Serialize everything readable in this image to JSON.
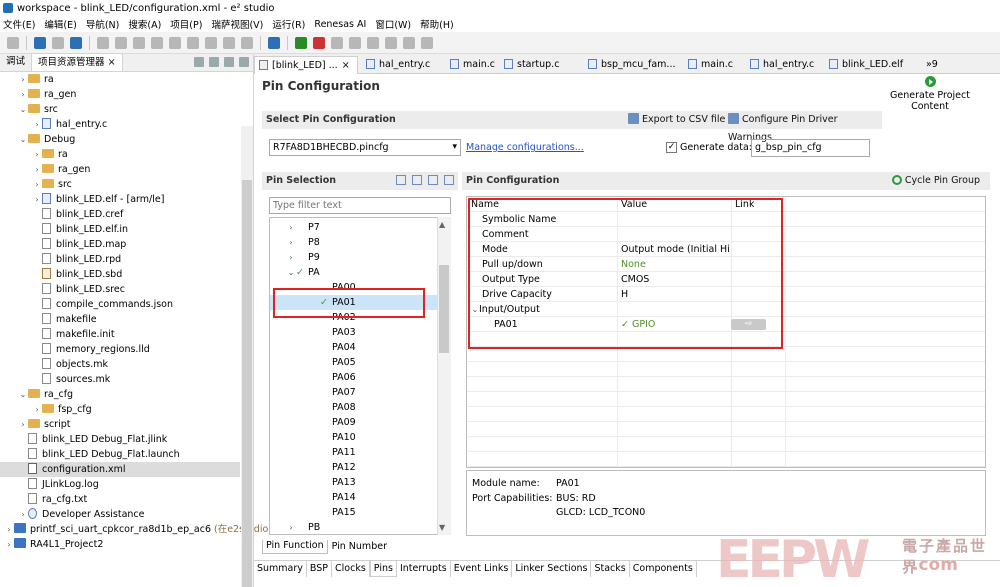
{
  "window": {
    "title": "workspace - blink_LED/configuration.xml - e² studio"
  },
  "menu": [
    "文件(E)",
    "编辑(E)",
    "导航(N)",
    "搜索(A)",
    "项目(P)",
    "瑞萨视图(V)",
    "运行(R)",
    "Renesas AI",
    "窗口(W)",
    "帮助(H)"
  ],
  "left_panel": {
    "tabs": [
      "调试",
      "项目资源管理器"
    ],
    "close_glyph": "×",
    "tree": [
      {
        "label": "ra",
        "depth": 1,
        "kind": "folder",
        "exp": "›"
      },
      {
        "label": "ra_gen",
        "depth": 1,
        "kind": "folder",
        "exp": "›"
      },
      {
        "label": "src",
        "depth": 1,
        "kind": "folder",
        "exp": "⌄"
      },
      {
        "label": "hal_entry.c",
        "depth": 2,
        "kind": "c",
        "exp": "›"
      },
      {
        "label": "Debug",
        "depth": 1,
        "kind": "folder",
        "exp": "⌄"
      },
      {
        "label": "ra",
        "depth": 2,
        "kind": "folder",
        "exp": "›"
      },
      {
        "label": "ra_gen",
        "depth": 2,
        "kind": "folder",
        "exp": "›"
      },
      {
        "label": "src",
        "depth": 2,
        "kind": "folder",
        "exp": "›"
      },
      {
        "label": "blink_LED.elf - [arm/le]",
        "depth": 2,
        "kind": "elf",
        "exp": "›"
      },
      {
        "label": "blink_LED.cref",
        "depth": 2,
        "kind": "file",
        "exp": ""
      },
      {
        "label": "blink_LED.elf.in",
        "depth": 2,
        "kind": "file",
        "exp": ""
      },
      {
        "label": "blink_LED.map",
        "depth": 2,
        "kind": "file",
        "exp": ""
      },
      {
        "label": "blink_LED.rpd",
        "depth": 2,
        "kind": "file",
        "exp": ""
      },
      {
        "label": "blink_LED.sbd",
        "depth": 2,
        "kind": "x",
        "exp": ""
      },
      {
        "label": "blink_LED.srec",
        "depth": 2,
        "kind": "file",
        "exp": ""
      },
      {
        "label": "compile_commands.json",
        "depth": 2,
        "kind": "file",
        "exp": ""
      },
      {
        "label": "makefile",
        "depth": 2,
        "kind": "file",
        "exp": ""
      },
      {
        "label": "makefile.init",
        "depth": 2,
        "kind": "file",
        "exp": ""
      },
      {
        "label": "memory_regions.lld",
        "depth": 2,
        "kind": "file",
        "exp": ""
      },
      {
        "label": "objects.mk",
        "depth": 2,
        "kind": "file",
        "exp": ""
      },
      {
        "label": "sources.mk",
        "depth": 2,
        "kind": "file",
        "exp": ""
      },
      {
        "label": "ra_cfg",
        "depth": 1,
        "kind": "folder",
        "exp": "⌄"
      },
      {
        "label": "fsp_cfg",
        "depth": 2,
        "kind": "folder",
        "exp": "›"
      },
      {
        "label": "script",
        "depth": 1,
        "kind": "folder",
        "exp": "›"
      },
      {
        "label": "blink_LED Debug_Flat.jlink",
        "depth": 1,
        "kind": "file",
        "exp": ""
      },
      {
        "label": "blink_LED Debug_Flat.launch",
        "depth": 1,
        "kind": "file",
        "exp": ""
      },
      {
        "label": "configuration.xml",
        "depth": 1,
        "kind": "gear",
        "exp": "",
        "selected": true
      },
      {
        "label": "JLinkLog.log",
        "depth": 1,
        "kind": "file",
        "exp": ""
      },
      {
        "label": "ra_cfg.txt",
        "depth": 1,
        "kind": "file",
        "exp": ""
      },
      {
        "label": "Developer Assistance",
        "depth": 1,
        "kind": "help",
        "exp": "›"
      },
      {
        "label": "printf_sci_uart_cpkcor_ra8d1b_ep_ac6",
        "depth": 0,
        "kind": "proj",
        "exp": "›",
        "extra": "(在e2studio"
      },
      {
        "label": "RA4L1_Project2",
        "depth": 0,
        "kind": "proj",
        "exp": "›"
      }
    ]
  },
  "editor_tabs": [
    {
      "label": "[blink_LED] ...",
      "active": true,
      "close": "×"
    },
    {
      "label": "hal_entry.c"
    },
    {
      "label": "main.c"
    },
    {
      "label": "startup.c"
    },
    {
      "label": "bsp_mcu_fam..."
    },
    {
      "label": "main.c"
    },
    {
      "label": "hal_entry.c"
    },
    {
      "label": "blink_LED.elf"
    },
    {
      "label": "»9"
    }
  ],
  "page": {
    "title": "Pin Configuration",
    "generate_button": "Generate Project Content",
    "select_pin_config": {
      "header": "Select Pin Configuration",
      "export_csv": "Export to CSV file",
      "configure_warnings": "Configure Pin Driver Warnings",
      "selected_file": "R7FA8D1BHECBD.pincfg",
      "manage_link": "Manage configurations...",
      "generate_data_label": "Generate data:",
      "generate_data_checked": "✓",
      "generate_data_value": "g_bsp_pin_cfg"
    },
    "pin_selection": {
      "header": "Pin Selection",
      "filter_placeholder": "Type filter text",
      "items": [
        {
          "label": "P7",
          "depth": 1,
          "exp": "›"
        },
        {
          "label": "P8",
          "depth": 1,
          "exp": "›"
        },
        {
          "label": "P9",
          "depth": 1,
          "exp": "›"
        },
        {
          "label": "PA",
          "depth": 1,
          "exp": "⌄",
          "check": "✓"
        },
        {
          "label": "PA00",
          "depth": 2,
          "exp": ""
        },
        {
          "label": "PA01",
          "depth": 2,
          "exp": "",
          "check": "✓",
          "selected": true
        },
        {
          "label": "PA02",
          "depth": 2,
          "exp": ""
        },
        {
          "label": "PA03",
          "depth": 2,
          "exp": ""
        },
        {
          "label": "PA04",
          "depth": 2,
          "exp": ""
        },
        {
          "label": "PA05",
          "depth": 2,
          "exp": ""
        },
        {
          "label": "PA06",
          "depth": 2,
          "exp": ""
        },
        {
          "label": "PA07",
          "depth": 2,
          "exp": ""
        },
        {
          "label": "PA08",
          "depth": 2,
          "exp": ""
        },
        {
          "label": "PA09",
          "depth": 2,
          "exp": ""
        },
        {
          "label": "PA10",
          "depth": 2,
          "exp": ""
        },
        {
          "label": "PA11",
          "depth": 2,
          "exp": ""
        },
        {
          "label": "PA12",
          "depth": 2,
          "exp": ""
        },
        {
          "label": "PA13",
          "depth": 2,
          "exp": ""
        },
        {
          "label": "PA14",
          "depth": 2,
          "exp": ""
        },
        {
          "label": "PA15",
          "depth": 2,
          "exp": ""
        },
        {
          "label": "PB",
          "depth": 1,
          "exp": "›"
        }
      ]
    },
    "pin_configuration": {
      "header": "Pin Configuration",
      "cycle_button": "Cycle Pin Group",
      "columns": [
        "Name",
        "Value",
        "Link"
      ],
      "rows": [
        {
          "name": "Symbolic Name",
          "value": "",
          "indent": 1
        },
        {
          "name": "Comment",
          "value": "",
          "indent": 1
        },
        {
          "name": "Mode",
          "value": "Output mode (Initial Hi...",
          "indent": 1
        },
        {
          "name": "Pull up/down",
          "value": "None",
          "indent": 1,
          "green": true
        },
        {
          "name": "Output Type",
          "value": "CMOS",
          "indent": 1
        },
        {
          "name": "Drive Capacity",
          "value": "H",
          "indent": 1
        },
        {
          "name": "Input/Output",
          "value": "",
          "indent": 0,
          "exp": "⌄"
        },
        {
          "name": "PA01",
          "value": "GPIO",
          "indent": 2,
          "check": "✓",
          "green": true,
          "link": "⇨"
        }
      ]
    },
    "module_info": {
      "module_name_label": "Module name:",
      "module_name": "PA01",
      "port_cap_label": "Port Capabilities:",
      "cap1": "BUS: RD",
      "cap2": "GLCD: LCD_TCON0"
    },
    "sub_tabs": [
      "Pin Function",
      "Pin Number"
    ],
    "bottom_tabs": [
      "Summary",
      "BSP",
      "Clocks",
      "Pins",
      "Interrupts",
      "Event Links",
      "Linker Sections",
      "Stacks",
      "Components"
    ],
    "active_bottom_tab": "Pins"
  },
  "watermark": {
    "logo": "EEPW",
    "cn": "電子產品世界",
    "url": ".com"
  },
  "colors": {
    "highlight": "#e02222",
    "accent": "#2255cc",
    "check": "#3a9a3a"
  }
}
